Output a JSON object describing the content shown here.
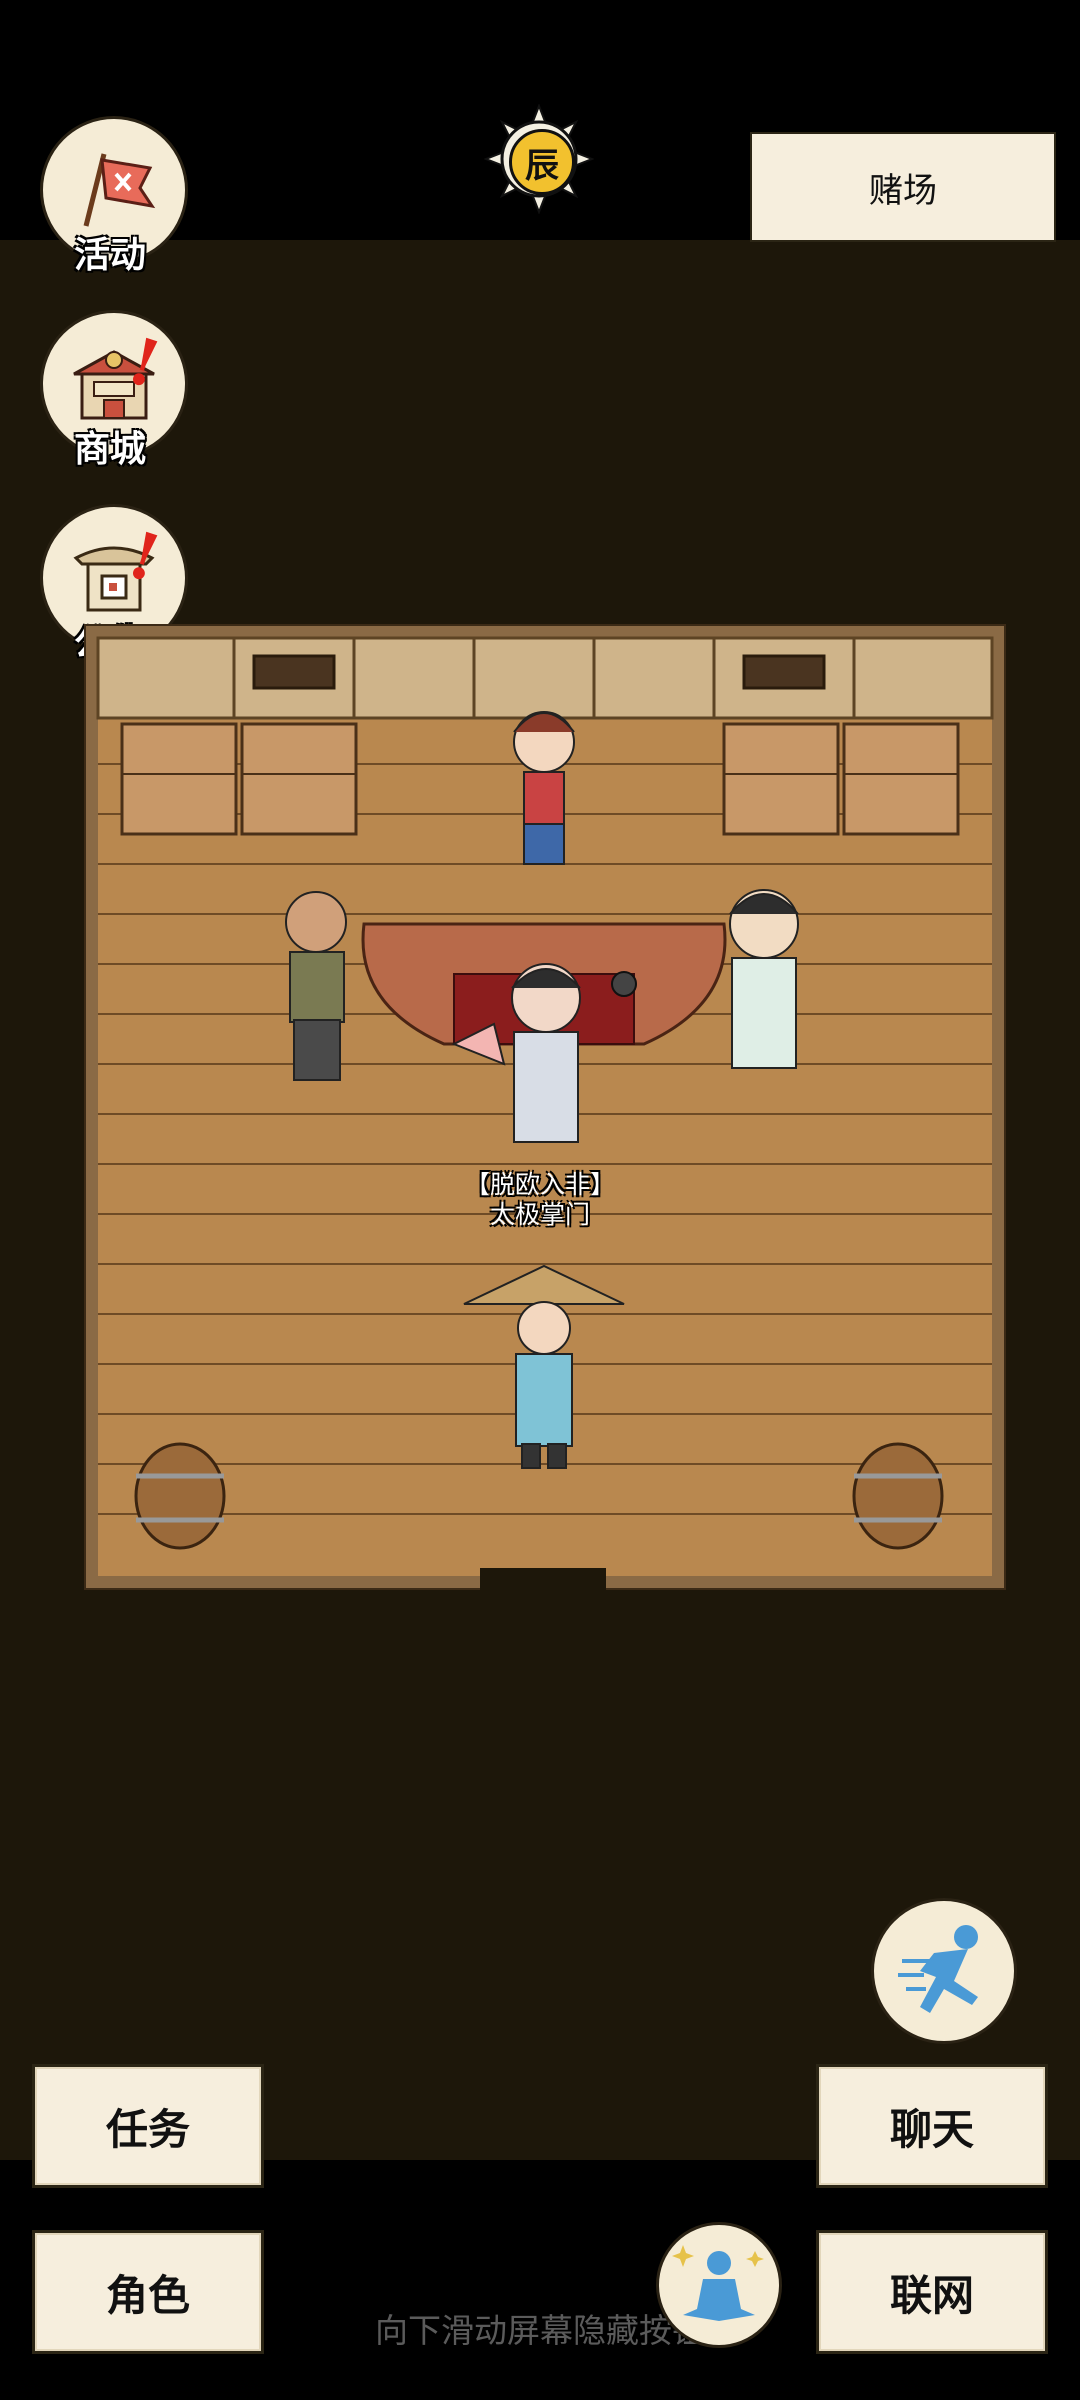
{
  "header": {
    "time_glyph": "辰",
    "location": "赌场"
  },
  "side_menu": {
    "activity_label": "活动",
    "shop_label": "商城",
    "notice_label": "公告",
    "alert_glyph": "!"
  },
  "scene": {
    "npc_title": "【脱欧入非】",
    "npc_role": "太极掌门"
  },
  "bottom": {
    "quest_label": "任务",
    "character_label": "角色",
    "chat_label": "聊天",
    "online_label": "联网",
    "swipe_hint": "向下滑动屏幕隐藏按钮"
  },
  "icons": {
    "activity": "banner-flag-icon",
    "shop": "shop-stall-icon",
    "notice": "notice-board-icon",
    "sprint": "running-figure-icon",
    "meditate": "meditating-figure-icon",
    "time": "sun-badge-icon"
  },
  "colors": {
    "background": "#1d170a",
    "paper": "#f6eedd",
    "floor": "#b9884f",
    "alert": "#e0241b",
    "accent_blue": "#4a9ad6"
  }
}
